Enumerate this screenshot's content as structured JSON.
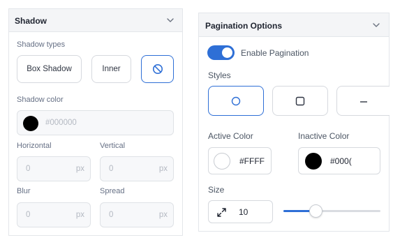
{
  "shadow_panel": {
    "title": "Shadow",
    "shadow_types_label": "Shadow types",
    "types": [
      "Box Shadow",
      "Inner"
    ],
    "selected_type": "none",
    "color_label": "Shadow color",
    "color_value": "#000000",
    "color_swatch": "#000000",
    "horizontal": {
      "label": "Horizontal",
      "value": "0",
      "unit": "px"
    },
    "vertical": {
      "label": "Vertical",
      "value": "0",
      "unit": "px"
    },
    "blur": {
      "label": "Blur",
      "value": "0",
      "unit": "px"
    },
    "spread": {
      "label": "Spread",
      "value": "0",
      "unit": "px"
    }
  },
  "pagination_panel": {
    "title": "Pagination Options",
    "enable_label": "Enable Pagination",
    "enabled": true,
    "styles_label": "Styles",
    "style_options": [
      "circle-icon",
      "square-icon",
      "dash-icon"
    ],
    "selected_style": "circle",
    "active_color": {
      "label": "Active Color",
      "value": "#FFFF",
      "swatch": "#ffffff"
    },
    "inactive_color": {
      "label": "Inactive Color",
      "value": "#000(",
      "swatch": "#000000"
    },
    "size": {
      "label": "Size",
      "value": "10",
      "slider_fraction": 0.33
    },
    "accent": "#2e6fd6"
  }
}
